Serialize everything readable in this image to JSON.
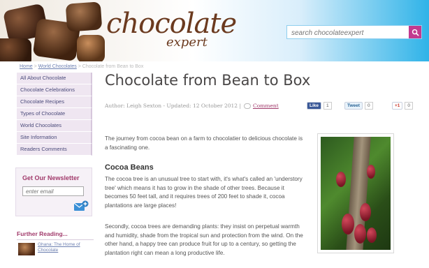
{
  "header": {
    "logo_main": "chocolate",
    "logo_sub": "expert",
    "search_placeholder": "search chocolateexpert"
  },
  "breadcrumb": {
    "home": "Home",
    "sep1": " > ",
    "section": "World Chocolates",
    "sep2": " > ",
    "current": "Chocolate from Bean to Box"
  },
  "sidebar": {
    "items": [
      {
        "label": "All About Chocolate"
      },
      {
        "label": "Chocolate Celebrations"
      },
      {
        "label": "Chocolate Recipes"
      },
      {
        "label": "Types of Chocolate"
      },
      {
        "label": "World Chocolates"
      },
      {
        "label": "Site Information"
      },
      {
        "label": "Readers Comments"
      }
    ],
    "newsletter": {
      "title": "Get Our Newsletter",
      "placeholder": "enter email"
    },
    "further": {
      "title": "Further Reading...",
      "link": "Ghana: The Home of Chocolate"
    }
  },
  "article": {
    "title": "Chocolate from Bean to Box",
    "meta": "Author: Leigh Sexton - Updated: 12 October 2012 |",
    "comment_label": "Comment",
    "social": {
      "like_label": "Like",
      "like_count": "1",
      "tweet_label": "Tweet",
      "tweet_count": "0",
      "plus_label": "+1",
      "plus_count": "0"
    },
    "intro": "The journey from cocoa bean on a farm to chocolatier to delicious chocolate is a fascinating one.",
    "section_heading": "Cocoa Beans",
    "para1": "The cocoa tree is an unusual tree to start with, it's what's called an 'understory tree' which means it has to grow in the shade of other trees. Because it becomes 50 feet tall, and it requires trees of 200 feet to shade it, cocoa plantations are large places!",
    "para2": "Secondly, cocoa trees are demanding plants: they insist on perpetual warmth and humidity, shade from the tropical sun and protection from the wind. On the other hand, a happy tree can produce fruit for up to a century, so getting the plantation right can mean a long productive life."
  },
  "colors": {
    "accent": "#a13a6b",
    "link": "#6c7fb0",
    "search_button": "#c23a8f",
    "header_blue": "#2fb3e8"
  },
  "icons": {
    "search": "magnifier-icon",
    "newsletter_submit": "envelope-plus-icon",
    "comment": "speech-bubble-icon"
  }
}
